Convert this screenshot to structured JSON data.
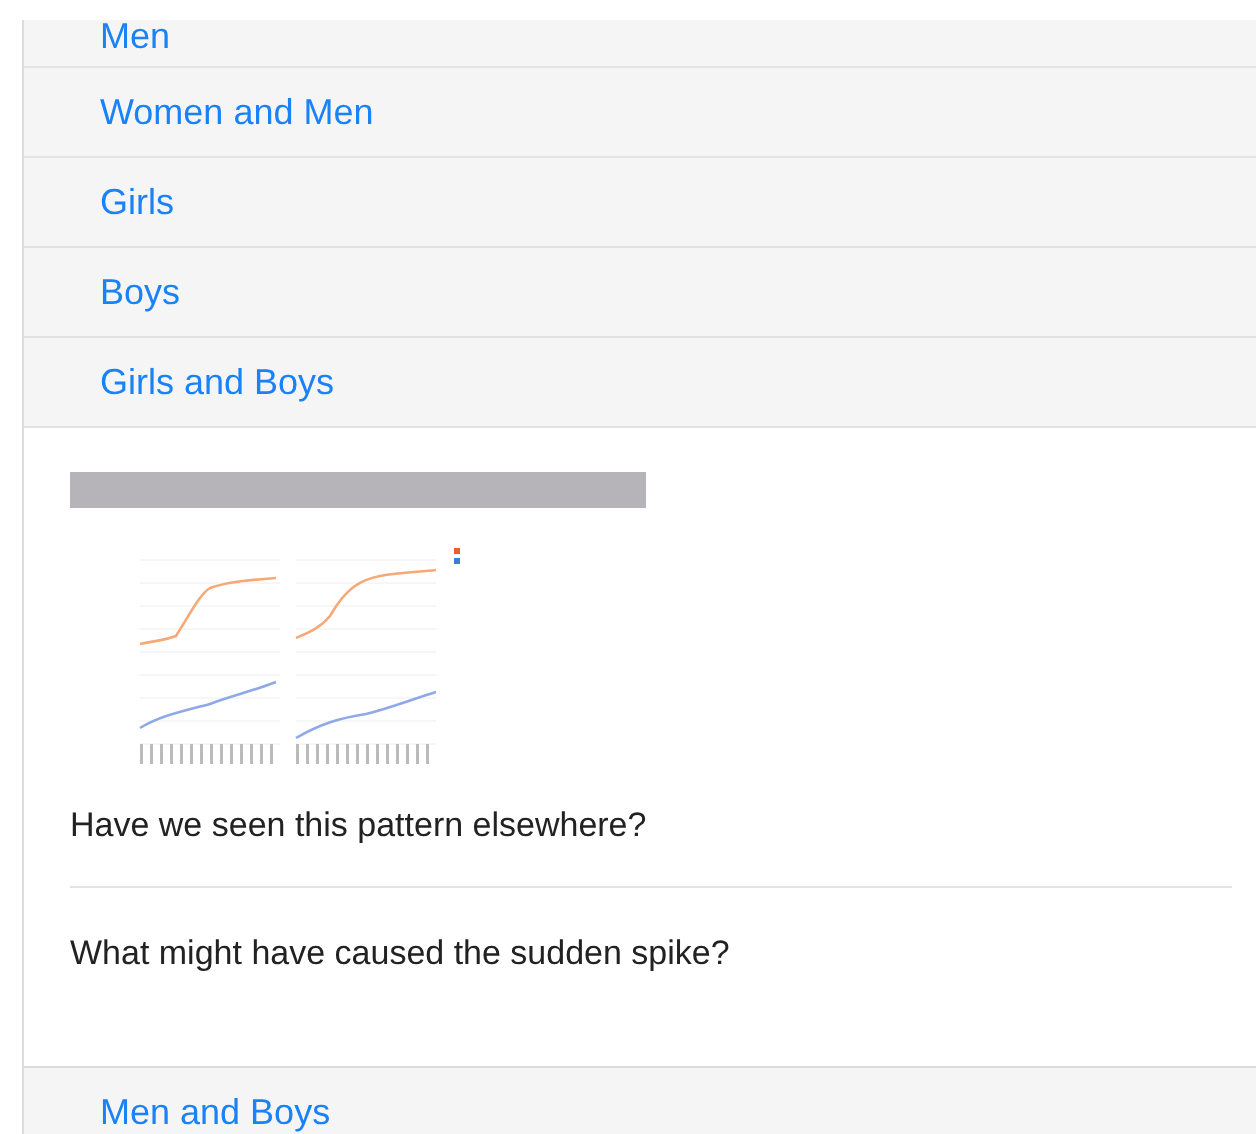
{
  "top_items": [
    {
      "label": "Men"
    },
    {
      "label": "Women and Men"
    },
    {
      "label": "Girls"
    },
    {
      "label": "Boys"
    },
    {
      "label": "Girls and Boys"
    }
  ],
  "panel": {
    "kind": "picture",
    "questions": [
      "Have we seen this pattern elsewhere?",
      "What might have caused the sudden spike?"
    ]
  },
  "bottom_items": [
    {
      "label": "Men and Boys"
    }
  ]
}
